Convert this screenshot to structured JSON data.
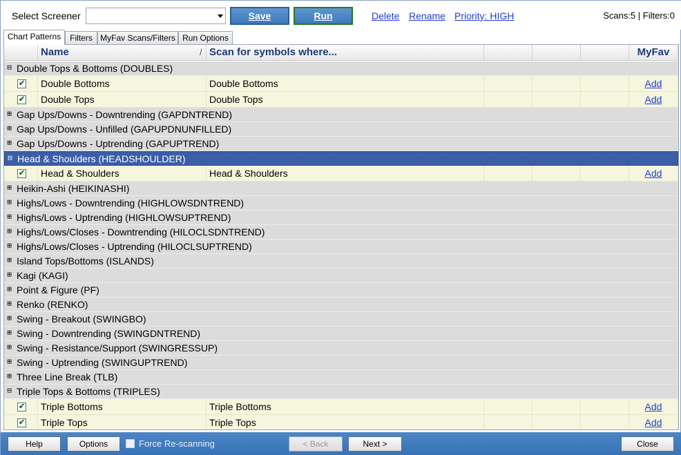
{
  "toolbar": {
    "select_label": "Select Screener",
    "select_value": "",
    "save_label": "Save",
    "run_label": "Run",
    "delete_label": "Delete",
    "rename_label": "Rename",
    "priority_label": "Priority: HIGH",
    "scan_count": "Scans:5 | Filters:0"
  },
  "tabs": [
    {
      "label": "Chart Patterns",
      "active": true
    },
    {
      "label": "Filters",
      "active": false
    },
    {
      "label": "MyFav Scans/Filters",
      "active": false
    },
    {
      "label": "Run Options",
      "active": false
    }
  ],
  "grid": {
    "columns": {
      "name": "Name",
      "sort_indicator": "/",
      "scan": "Scan for symbols where...",
      "myfav": "MyFav"
    },
    "rows": [
      {
        "type": "group",
        "expanded": true,
        "label": "Double Tops & Bottoms (DOUBLES)"
      },
      {
        "type": "item",
        "checked": true,
        "name": "Double Bottoms",
        "scan": "Double Bottoms",
        "fav": "Add"
      },
      {
        "type": "item",
        "checked": true,
        "name": "Double Tops",
        "scan": "Double Tops",
        "fav": "Add"
      },
      {
        "type": "group",
        "expanded": false,
        "label": "Gap Ups/Downs - Downtrending (GAPDNTREND)"
      },
      {
        "type": "group",
        "expanded": false,
        "label": "Gap Ups/Downs - Unfilled (GAPUPDNUNFILLED)"
      },
      {
        "type": "group",
        "expanded": false,
        "label": "Gap Ups/Downs - Uptrending (GAPUPTREND)"
      },
      {
        "type": "group",
        "expanded": true,
        "selected": true,
        "label": "Head & Shoulders (HEADSHOULDER)"
      },
      {
        "type": "item",
        "checked": true,
        "name": "Head & Shoulders",
        "scan": "Head & Shoulders",
        "fav": "Add"
      },
      {
        "type": "group",
        "expanded": false,
        "label": "Heikin-Ashi (HEIKINASHI)"
      },
      {
        "type": "group",
        "expanded": false,
        "label": "Highs/Lows - Downtrending (HIGHLOWSDNTREND)"
      },
      {
        "type": "group",
        "expanded": false,
        "label": "Highs/Lows - Uptrending (HIGHLOWSUPTREND)"
      },
      {
        "type": "group",
        "expanded": false,
        "label": "Highs/Lows/Closes - Downtrending (HILOCLSDNTREND)"
      },
      {
        "type": "group",
        "expanded": false,
        "label": "Highs/Lows/Closes - Uptrending (HILOCLSUPTREND)"
      },
      {
        "type": "group",
        "expanded": false,
        "label": "Island Tops/Bottoms (ISLANDS)"
      },
      {
        "type": "group",
        "expanded": false,
        "label": "Kagi (KAGI)"
      },
      {
        "type": "group",
        "expanded": false,
        "label": "Point & Figure (PF)"
      },
      {
        "type": "group",
        "expanded": false,
        "label": "Renko (RENKO)"
      },
      {
        "type": "group",
        "expanded": false,
        "label": "Swing - Breakout (SWINGBO)"
      },
      {
        "type": "group",
        "expanded": false,
        "label": "Swing - Downtrending (SWINGDNTREND)"
      },
      {
        "type": "group",
        "expanded": false,
        "label": "Swing - Resistance/Support (SWINGRESSUP)"
      },
      {
        "type": "group",
        "expanded": false,
        "label": "Swing - Uptrending (SWINGUPTREND)"
      },
      {
        "type": "group",
        "expanded": false,
        "label": "Three Line Break (TLB)"
      },
      {
        "type": "group",
        "expanded": true,
        "label": "Triple Tops & Bottoms (TRIPLES)"
      },
      {
        "type": "item",
        "checked": true,
        "name": "Triple Bottoms",
        "scan": "Triple Bottoms",
        "fav": "Add"
      },
      {
        "type": "item",
        "checked": true,
        "name": "Triple Tops",
        "scan": "Triple Tops",
        "fav": "Add"
      }
    ]
  },
  "bottom": {
    "help_label": "Help",
    "options_label": "Options",
    "force_label": "Force Re-scanning",
    "force_checked": false,
    "back_label": "< Back",
    "next_label": "Next >",
    "close_label": "Close"
  }
}
